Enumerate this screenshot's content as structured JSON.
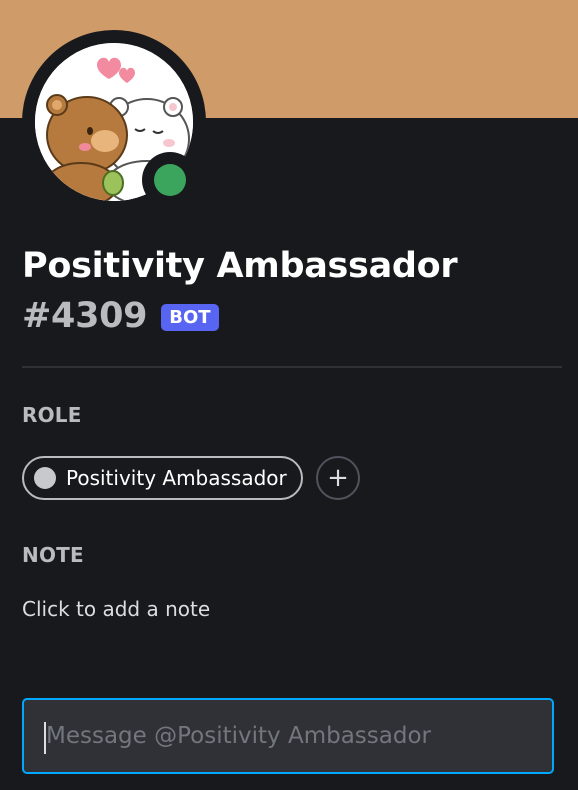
{
  "colors": {
    "banner": "#cf9b68",
    "status_online": "#3ba55d",
    "bot_badge": "#5865f2",
    "role_color": "#c7c9cc",
    "input_focus": "#00a8fc"
  },
  "user": {
    "display_name": "Positivity Ambassador",
    "discriminator": "#4309",
    "badge": "BOT",
    "status": "online"
  },
  "sections": {
    "role": {
      "title": "ROLE",
      "roles": [
        {
          "name": "Positivity Ambassador"
        }
      ],
      "add_label": "+"
    },
    "note": {
      "title": "NOTE",
      "placeholder": "Click to add a note"
    }
  },
  "message": {
    "placeholder": "Message @Positivity Ambassador",
    "value": ""
  },
  "icons": {
    "avatar": "bear-couple-avatar",
    "status": "online-status-icon",
    "add": "plus-icon"
  }
}
